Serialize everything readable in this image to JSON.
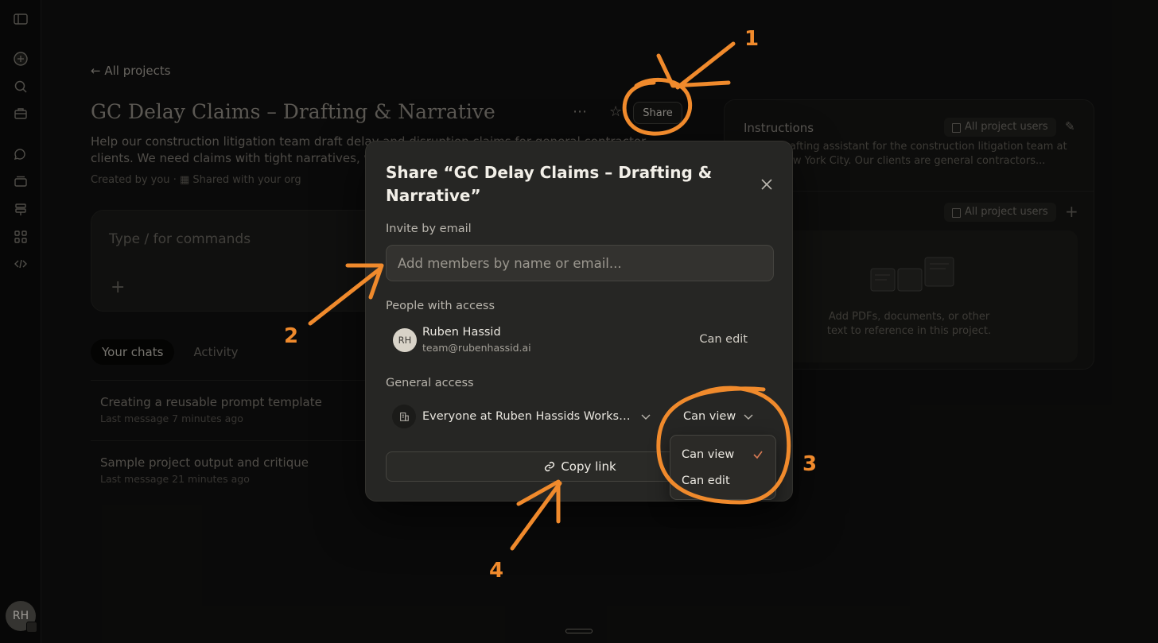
{
  "back_link": "All projects",
  "project": {
    "title": "GC Delay Claims – Drafting & Narrative",
    "description": "Help our construction litigation team draft delay and disruption claims for general contractor clients. We need claims with tight narratives, well-structured chronologies and persuasive entitlement.",
    "created_by": "Created by you",
    "shared_with": "Shared with your org",
    "share_label": "Share",
    "more_icon": "more-horizontal-icon",
    "star_icon": "star-icon"
  },
  "composer": {
    "placeholder": "Type / for commands",
    "add_icon": "plus-icon"
  },
  "tabs": [
    "Your chats",
    "Activity"
  ],
  "chats": [
    {
      "title": "Creating a reusable prompt template",
      "subtitle": "Last message 7 minutes ago"
    },
    {
      "title": "Sample project output and critique",
      "subtitle": "Last message 21 minutes ago"
    }
  ],
  "instructions_panel": {
    "title": "Instructions",
    "visibility": "All project users",
    "text": "...egal drafting assistant for the construction litigation team at ...al in New York City. Our clients are general contractors...",
    "files_visibility": "All project users",
    "files_empty_text": "Add PDFs, documents, or other text to reference in this project."
  },
  "sidebar": {
    "icons": [
      "sidebar-toggle-icon",
      "new-chat-icon",
      "search-icon",
      "briefcase-icon",
      "chats-icon",
      "projects-icon",
      "signpost-icon",
      "apps-icon",
      "code-icon"
    ],
    "avatar_initials": "RH"
  },
  "modal": {
    "title": "Share “GC Delay Claims – Drafting & Narrative”",
    "invite_label": "Invite by email",
    "invite_placeholder": "Add members by name or email...",
    "people_label": "People with access",
    "person": {
      "initials": "RH",
      "name": "Ruben Hassid",
      "email": "team@rubenhassid.ai",
      "role": "Can edit"
    },
    "general_label": "General access",
    "general_scope": "Everyone at Ruben Hassids Workspace",
    "general_permission": "Can view",
    "copy_link": "Copy link"
  },
  "permission_dropdown": {
    "options": [
      "Can view",
      "Can edit"
    ],
    "selected": "Can view"
  },
  "annotations": [
    "1",
    "2",
    "3",
    "4"
  ],
  "colors": {
    "annotation": "#f08a2c",
    "check": "#d77a54",
    "modal_bg": "#262624"
  }
}
